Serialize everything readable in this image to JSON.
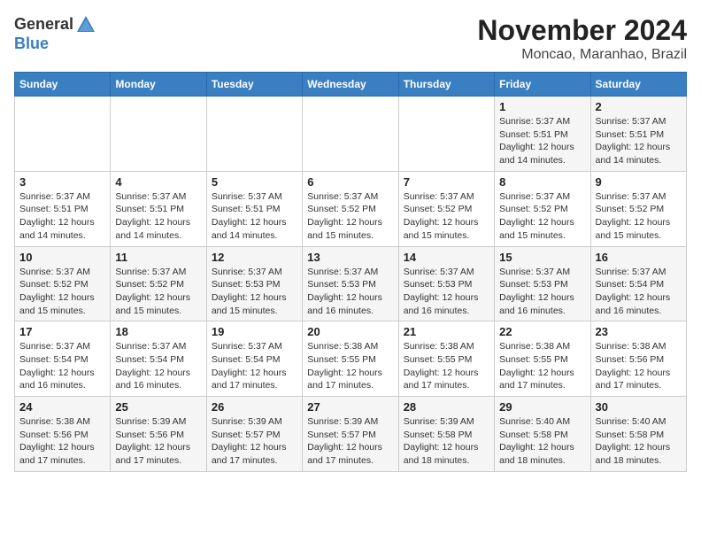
{
  "logo": {
    "general": "General",
    "blue": "Blue"
  },
  "header": {
    "month": "November 2024",
    "location": "Moncao, Maranhao, Brazil"
  },
  "days_of_week": [
    "Sunday",
    "Monday",
    "Tuesday",
    "Wednesday",
    "Thursday",
    "Friday",
    "Saturday"
  ],
  "weeks": [
    [
      {
        "day": "",
        "info": ""
      },
      {
        "day": "",
        "info": ""
      },
      {
        "day": "",
        "info": ""
      },
      {
        "day": "",
        "info": ""
      },
      {
        "day": "",
        "info": ""
      },
      {
        "day": "1",
        "info": "Sunrise: 5:37 AM\nSunset: 5:51 PM\nDaylight: 12 hours and 14 minutes."
      },
      {
        "day": "2",
        "info": "Sunrise: 5:37 AM\nSunset: 5:51 PM\nDaylight: 12 hours and 14 minutes."
      }
    ],
    [
      {
        "day": "3",
        "info": "Sunrise: 5:37 AM\nSunset: 5:51 PM\nDaylight: 12 hours and 14 minutes."
      },
      {
        "day": "4",
        "info": "Sunrise: 5:37 AM\nSunset: 5:51 PM\nDaylight: 12 hours and 14 minutes."
      },
      {
        "day": "5",
        "info": "Sunrise: 5:37 AM\nSunset: 5:51 PM\nDaylight: 12 hours and 14 minutes."
      },
      {
        "day": "6",
        "info": "Sunrise: 5:37 AM\nSunset: 5:52 PM\nDaylight: 12 hours and 15 minutes."
      },
      {
        "day": "7",
        "info": "Sunrise: 5:37 AM\nSunset: 5:52 PM\nDaylight: 12 hours and 15 minutes."
      },
      {
        "day": "8",
        "info": "Sunrise: 5:37 AM\nSunset: 5:52 PM\nDaylight: 12 hours and 15 minutes."
      },
      {
        "day": "9",
        "info": "Sunrise: 5:37 AM\nSunset: 5:52 PM\nDaylight: 12 hours and 15 minutes."
      }
    ],
    [
      {
        "day": "10",
        "info": "Sunrise: 5:37 AM\nSunset: 5:52 PM\nDaylight: 12 hours and 15 minutes."
      },
      {
        "day": "11",
        "info": "Sunrise: 5:37 AM\nSunset: 5:52 PM\nDaylight: 12 hours and 15 minutes."
      },
      {
        "day": "12",
        "info": "Sunrise: 5:37 AM\nSunset: 5:53 PM\nDaylight: 12 hours and 15 minutes."
      },
      {
        "day": "13",
        "info": "Sunrise: 5:37 AM\nSunset: 5:53 PM\nDaylight: 12 hours and 16 minutes."
      },
      {
        "day": "14",
        "info": "Sunrise: 5:37 AM\nSunset: 5:53 PM\nDaylight: 12 hours and 16 minutes."
      },
      {
        "day": "15",
        "info": "Sunrise: 5:37 AM\nSunset: 5:53 PM\nDaylight: 12 hours and 16 minutes."
      },
      {
        "day": "16",
        "info": "Sunrise: 5:37 AM\nSunset: 5:54 PM\nDaylight: 12 hours and 16 minutes."
      }
    ],
    [
      {
        "day": "17",
        "info": "Sunrise: 5:37 AM\nSunset: 5:54 PM\nDaylight: 12 hours and 16 minutes."
      },
      {
        "day": "18",
        "info": "Sunrise: 5:37 AM\nSunset: 5:54 PM\nDaylight: 12 hours and 16 minutes."
      },
      {
        "day": "19",
        "info": "Sunrise: 5:37 AM\nSunset: 5:54 PM\nDaylight: 12 hours and 17 minutes."
      },
      {
        "day": "20",
        "info": "Sunrise: 5:38 AM\nSunset: 5:55 PM\nDaylight: 12 hours and 17 minutes."
      },
      {
        "day": "21",
        "info": "Sunrise: 5:38 AM\nSunset: 5:55 PM\nDaylight: 12 hours and 17 minutes."
      },
      {
        "day": "22",
        "info": "Sunrise: 5:38 AM\nSunset: 5:55 PM\nDaylight: 12 hours and 17 minutes."
      },
      {
        "day": "23",
        "info": "Sunrise: 5:38 AM\nSunset: 5:56 PM\nDaylight: 12 hours and 17 minutes."
      }
    ],
    [
      {
        "day": "24",
        "info": "Sunrise: 5:38 AM\nSunset: 5:56 PM\nDaylight: 12 hours and 17 minutes."
      },
      {
        "day": "25",
        "info": "Sunrise: 5:39 AM\nSunset: 5:56 PM\nDaylight: 12 hours and 17 minutes."
      },
      {
        "day": "26",
        "info": "Sunrise: 5:39 AM\nSunset: 5:57 PM\nDaylight: 12 hours and 17 minutes."
      },
      {
        "day": "27",
        "info": "Sunrise: 5:39 AM\nSunset: 5:57 PM\nDaylight: 12 hours and 17 minutes."
      },
      {
        "day": "28",
        "info": "Sunrise: 5:39 AM\nSunset: 5:58 PM\nDaylight: 12 hours and 18 minutes."
      },
      {
        "day": "29",
        "info": "Sunrise: 5:40 AM\nSunset: 5:58 PM\nDaylight: 12 hours and 18 minutes."
      },
      {
        "day": "30",
        "info": "Sunrise: 5:40 AM\nSunset: 5:58 PM\nDaylight: 12 hours and 18 minutes."
      }
    ]
  ]
}
